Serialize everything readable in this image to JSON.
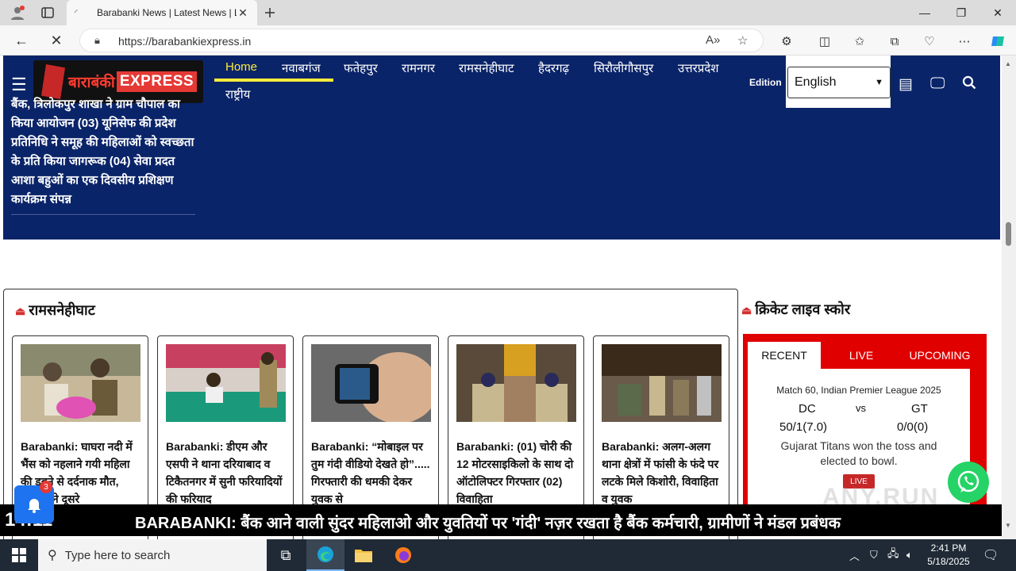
{
  "browser": {
    "tab_title": "Barabanki News | Latest News | L",
    "url": "https://barabankiexpress.in"
  },
  "site": {
    "logo_hindi": "बाराबंकी",
    "logo_english": "EXPRESS",
    "menu": [
      "Home",
      "नवाबगंज",
      "फतेहपुर",
      "रामनगर",
      "रामसनेहीघाट",
      "हैदरगढ़",
      "सिरौलीगौसपुर",
      "उत्तरप्रदेश",
      "राष्ट्रीय"
    ],
    "edition_label": "Edition",
    "edition_value": "English",
    "ticker_text": "बैंक, त्रिलोकपुर शाखा ने ग्राम चौपाल का किया आयोजन (03) यूनिसेफ की प्रदेश प्रतिनिधि ने समूह की महिलाओं को स्वच्छता के प्रति किया जागरूक (04) सेवा प्रदत आशा बहुओं का एक दिवसीय प्रशिक्षण कार्यक्रम संपन्न"
  },
  "section": {
    "title": "रामसनेहीघाट",
    "cards": [
      {
        "text": "Barabanki: घाघरा नदी में भैंस को नहलाने गयी महिला की डूबने से दर्दनाक मौत, ताखोरों ने दूसरे"
      },
      {
        "text": "Barabanki: डीएम और एसपी ने थाना दरियाबाद व टिकैतनगर में सुनी फरियादियों की फरियाद"
      },
      {
        "text": "Barabanki: “मोबाइल पर तुम गंदी वीडियो देखते हो”..... गिरफ्तारी की धमकी देकर युवक से"
      },
      {
        "text": "Barabanki: (01) चोरी की 12 मोटरसाइकिलो के साथ दो ऑटोलिफ्टर गिरफ्तार (02) विवाहिता"
      },
      {
        "text": "Barabanki: अलग-अलग थाना क्षेत्रों में फांसी के फंदे पर लटके मिले किशोरी, विवाहिता व युवक"
      }
    ]
  },
  "cricket": {
    "title": "क्रिकेट लाइव स्कोर",
    "tabs": [
      "RECENT",
      "LIVE",
      "UPCOMING"
    ],
    "match": "Match 60, Indian Premier League 2025",
    "team1": "DC",
    "vs": "vs",
    "team2": "GT",
    "score1": "50/1(7.0)",
    "score2": "0/0(0)",
    "info": "Gujarat Titans won the toss and elected to bowl.",
    "live_label": "LIVE"
  },
  "notification_count": "3",
  "newsbar": {
    "clock": "14:11",
    "breaking": "BARABANKI: बैंक आने वाली सुंदर महिलाओ और युवतियों पर 'गंदी' नज़र रखता है बैंक कर्मचारी, ग्रामीणों ने मंडल प्रबंधक"
  },
  "watermark": "ANY.RUN",
  "taskbar": {
    "search_placeholder": "Type here to search",
    "time": "2:41 PM",
    "date": "5/18/2025"
  }
}
